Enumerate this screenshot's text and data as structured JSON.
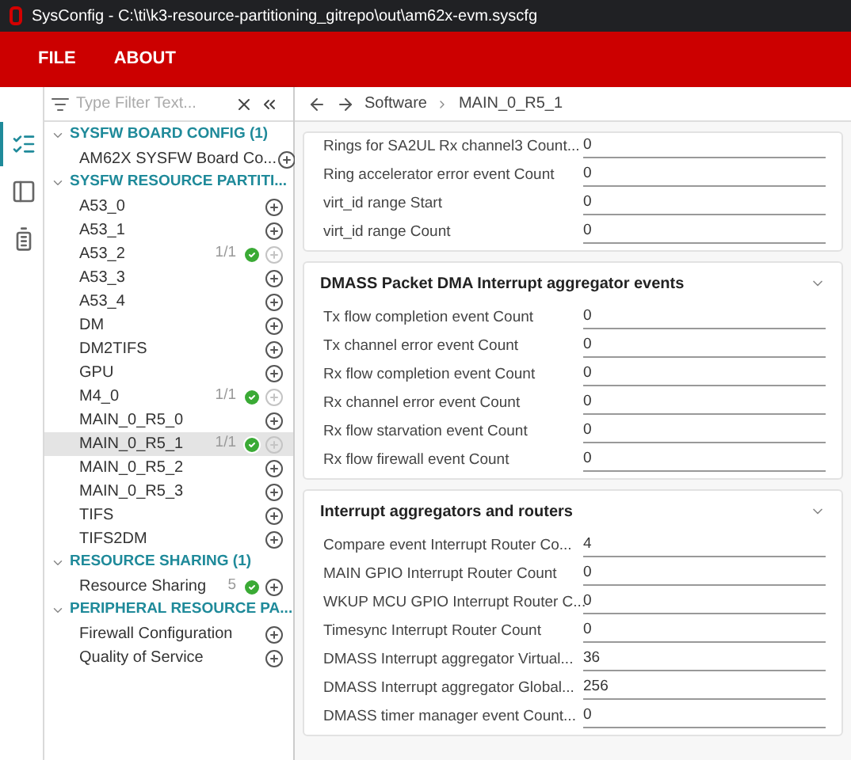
{
  "window": {
    "title": "SysConfig - C:\\ti\\k3-resource-partitioning_gitrepo\\out\\am62x-evm.syscfg"
  },
  "menu": [
    "FILE",
    "ABOUT"
  ],
  "rail": [
    {
      "kind": "list",
      "selected": true
    },
    {
      "kind": "panel",
      "selected": false
    },
    {
      "kind": "battery",
      "selected": false
    }
  ],
  "filter": {
    "placeholder": "Type Filter Text..."
  },
  "groups": [
    {
      "title": "SYSFW BOARD CONFIG (1)",
      "expanded": true,
      "items": [
        {
          "label": "AM62X SYSFW Board Co...",
          "selected": false,
          "ok": false,
          "add_enabled": true
        }
      ]
    },
    {
      "title": "SYSFW RESOURCE PARTITI...",
      "expanded": true,
      "items": [
        {
          "label": "A53_0",
          "selected": false,
          "ok": false,
          "add_enabled": true
        },
        {
          "label": "A53_1",
          "selected": false,
          "ok": false,
          "add_enabled": true
        },
        {
          "label": "A53_2",
          "count": "1/1",
          "selected": false,
          "ok": true,
          "add_enabled": false
        },
        {
          "label": "A53_3",
          "selected": false,
          "ok": false,
          "add_enabled": true
        },
        {
          "label": "A53_4",
          "selected": false,
          "ok": false,
          "add_enabled": true
        },
        {
          "label": "DM",
          "selected": false,
          "ok": false,
          "add_enabled": true
        },
        {
          "label": "DM2TIFS",
          "selected": false,
          "ok": false,
          "add_enabled": true
        },
        {
          "label": "GPU",
          "selected": false,
          "ok": false,
          "add_enabled": true
        },
        {
          "label": "M4_0",
          "count": "1/1",
          "selected": false,
          "ok": true,
          "add_enabled": false
        },
        {
          "label": "MAIN_0_R5_0",
          "selected": false,
          "ok": false,
          "add_enabled": true
        },
        {
          "label": "MAIN_0_R5_1",
          "count": "1/1",
          "selected": true,
          "ok": true,
          "add_enabled": false
        },
        {
          "label": "MAIN_0_R5_2",
          "selected": false,
          "ok": false,
          "add_enabled": true
        },
        {
          "label": "MAIN_0_R5_3",
          "selected": false,
          "ok": false,
          "add_enabled": true
        },
        {
          "label": "TIFS",
          "selected": false,
          "ok": false,
          "add_enabled": true
        },
        {
          "label": "TIFS2DM",
          "selected": false,
          "ok": false,
          "add_enabled": true
        }
      ]
    },
    {
      "title": "RESOURCE SHARING (1)",
      "expanded": true,
      "items": [
        {
          "label": "Resource Sharing",
          "count": "5",
          "selected": false,
          "ok": true,
          "add_enabled": true
        }
      ]
    },
    {
      "title": "PERIPHERAL RESOURCE PA...",
      "expanded": true,
      "items": [
        {
          "label": "Firewall Configuration",
          "selected": false,
          "ok": false,
          "add_enabled": true
        },
        {
          "label": "Quality of Service",
          "selected": false,
          "ok": false,
          "add_enabled": true
        }
      ]
    }
  ],
  "breadcrumb": [
    "Software",
    "MAIN_0_R5_1"
  ],
  "sections": [
    {
      "fields": [
        {
          "label": "Rings for SA2UL Rx channel3 Count...",
          "value": "0"
        },
        {
          "label": "Ring accelerator error event Count",
          "value": "0"
        },
        {
          "label": "virt_id range Start",
          "value": "0"
        },
        {
          "label": "virt_id range Count",
          "value": "0"
        }
      ]
    },
    {
      "title": "DMASS Packet DMA Interrupt aggregator events",
      "expanded": true,
      "fields": [
        {
          "label": "Tx flow completion event Count",
          "value": "0"
        },
        {
          "label": "Tx channel error event Count",
          "value": "0"
        },
        {
          "label": "Rx flow completion event Count",
          "value": "0"
        },
        {
          "label": "Rx channel error event Count",
          "value": "0"
        },
        {
          "label": "Rx flow starvation event Count",
          "value": "0"
        },
        {
          "label": "Rx flow firewall event Count",
          "value": "0"
        }
      ]
    },
    {
      "title": "Interrupt aggregators and routers",
      "expanded": true,
      "fields": [
        {
          "label": "Compare event Interrupt Router Co...",
          "value": "4"
        },
        {
          "label": "MAIN GPIO Interrupt Router Count",
          "value": "0"
        },
        {
          "label": "WKUP MCU GPIO Interrupt Router C...",
          "value": "0"
        },
        {
          "label": "Timesync Interrupt Router Count",
          "value": "0"
        },
        {
          "label": "DMASS Interrupt aggregator Virtual...",
          "value": "36"
        },
        {
          "label": "DMASS Interrupt aggregator Global...",
          "value": "256"
        },
        {
          "label": "DMASS timer manager event Count...",
          "value": "0"
        }
      ]
    }
  ]
}
